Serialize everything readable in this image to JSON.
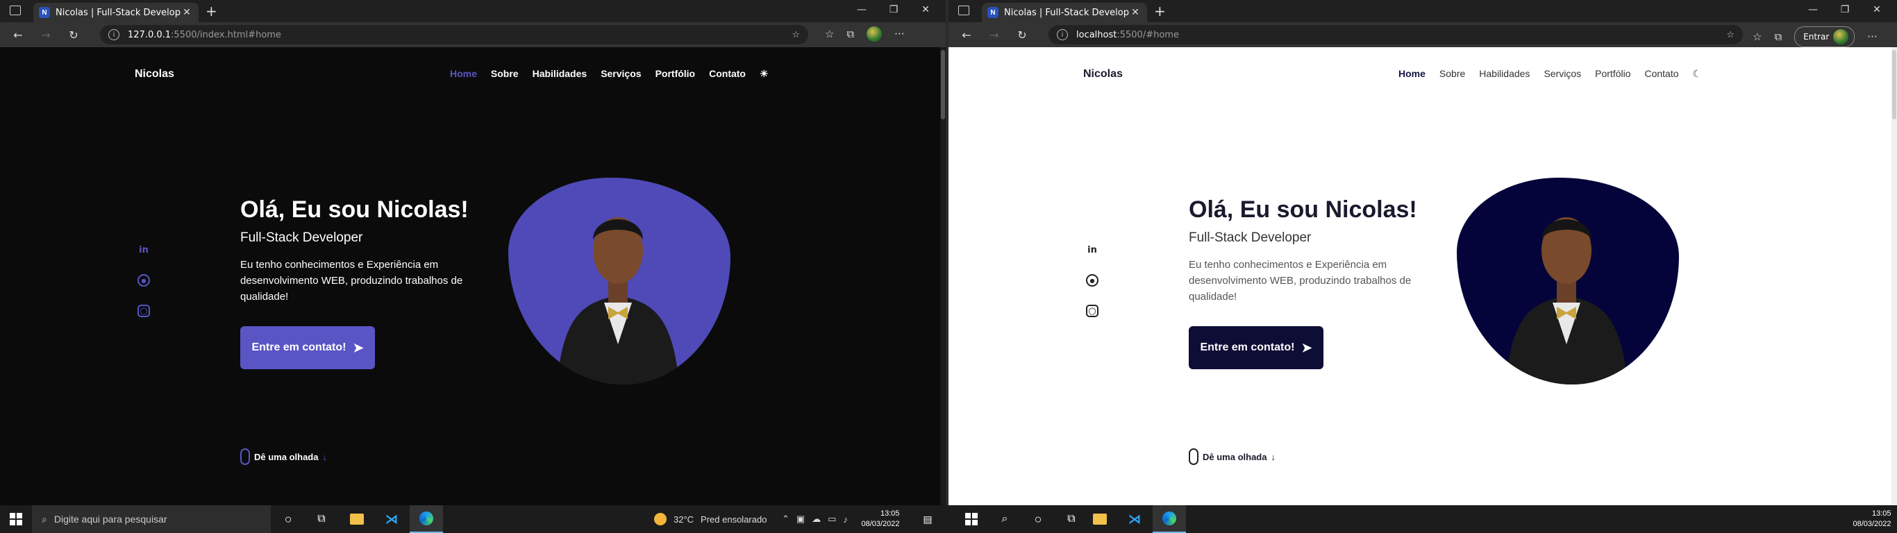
{
  "left_browser": {
    "tab_title": "Nicolas | Full-Stack Developer",
    "url_host": "127.0.0.1",
    "url_path": ":5500/index.html#home",
    "theme": "dark"
  },
  "right_browser": {
    "tab_title": "Nicolas | Full-Stack Developer",
    "url_host": "localhost",
    "url_path": ":5500/#home",
    "login_label": "Entrar",
    "theme": "light"
  },
  "site": {
    "brand": "Nicolas",
    "menu": [
      "Home",
      "Sobre",
      "Habilidades",
      "Serviços",
      "Portfólio",
      "Contato"
    ],
    "active_menu": "Home",
    "hero_title": "Olá, Eu sou Nicolas!",
    "hero_subtitle": "Full-Stack Developer",
    "hero_description": "Eu tenho conhecimentos e Experiência em desenvolvimento WEB, produzindo trabalhos de qualidade!",
    "cta_label": "Entre em contato!",
    "scroll_label": "Dê uma olhada",
    "socials": [
      "linkedin-icon",
      "github-icon",
      "instagram-icon"
    ]
  },
  "taskbar": {
    "search_placeholder": "Digite aqui para pesquisar",
    "weather_temp": "32°C",
    "weather_text": "Pred ensolarado",
    "time": "13:05",
    "date": "08/03/2022"
  },
  "colors": {
    "dark_accent": "#5955c5",
    "light_accent": "#0d0d35"
  }
}
